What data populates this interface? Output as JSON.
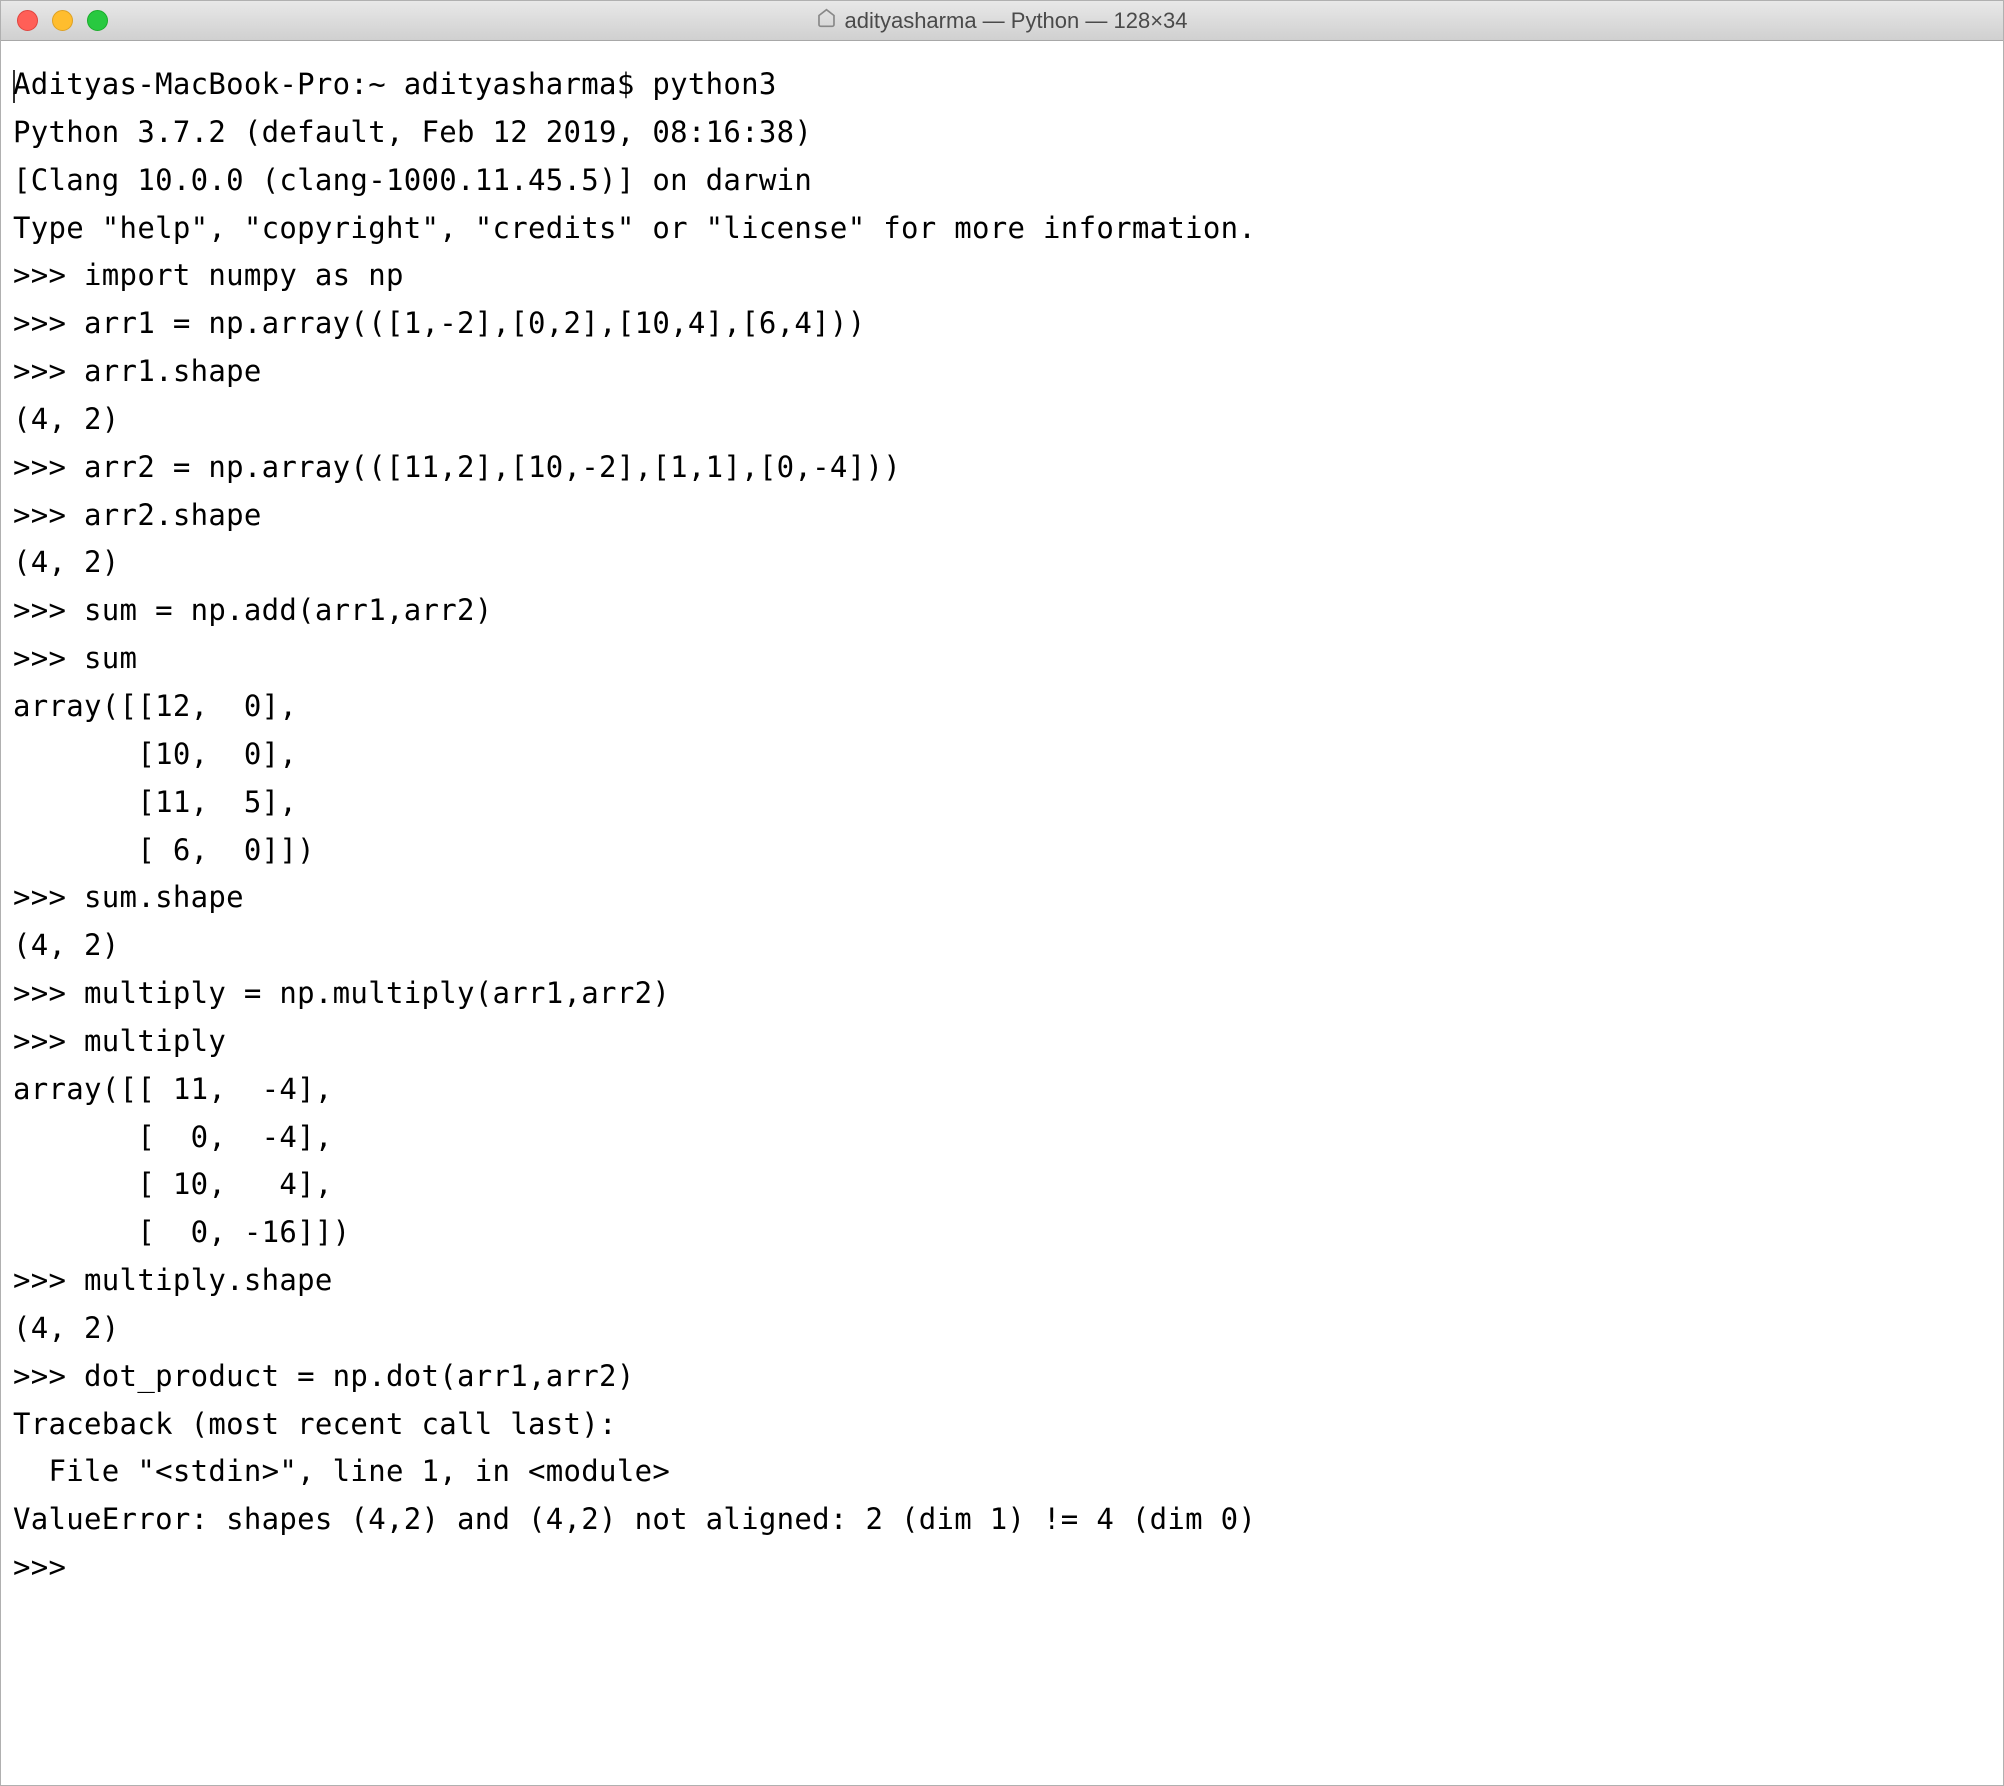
{
  "titlebar": {
    "title": "adityasharma — Python — 128×34"
  },
  "terminal": {
    "lines": [
      "Adityas-MacBook-Pro:~ adityasharma$ python3",
      "Python 3.7.2 (default, Feb 12 2019, 08:16:38)",
      "[Clang 10.0.0 (clang-1000.11.45.5)] on darwin",
      "Type \"help\", \"copyright\", \"credits\" or \"license\" for more information.",
      ">>> import numpy as np",
      ">>> arr1 = np.array(([1,-2],[0,2],[10,4],[6,4]))",
      ">>> arr1.shape",
      "(4, 2)",
      ">>> arr2 = np.array(([11,2],[10,-2],[1,1],[0,-4]))",
      ">>> arr2.shape",
      "(4, 2)",
      ">>> sum = np.add(arr1,arr2)",
      ">>> sum",
      "array([[12,  0],",
      "       [10,  0],",
      "       [11,  5],",
      "       [ 6,  0]])",
      ">>> sum.shape",
      "(4, 2)",
      ">>> multiply = np.multiply(arr1,arr2)",
      ">>> multiply",
      "array([[ 11,  -4],",
      "       [  0,  -4],",
      "       [ 10,   4],",
      "       [  0, -16]])",
      ">>> multiply.shape",
      "(4, 2)",
      ">>> dot_product = np.dot(arr1,arr2)",
      "Traceback (most recent call last):",
      "  File \"<stdin>\", line 1, in <module>",
      "ValueError: shapes (4,2) and (4,2) not aligned: 2 (dim 1) != 4 (dim 0)",
      ">>> "
    ]
  }
}
